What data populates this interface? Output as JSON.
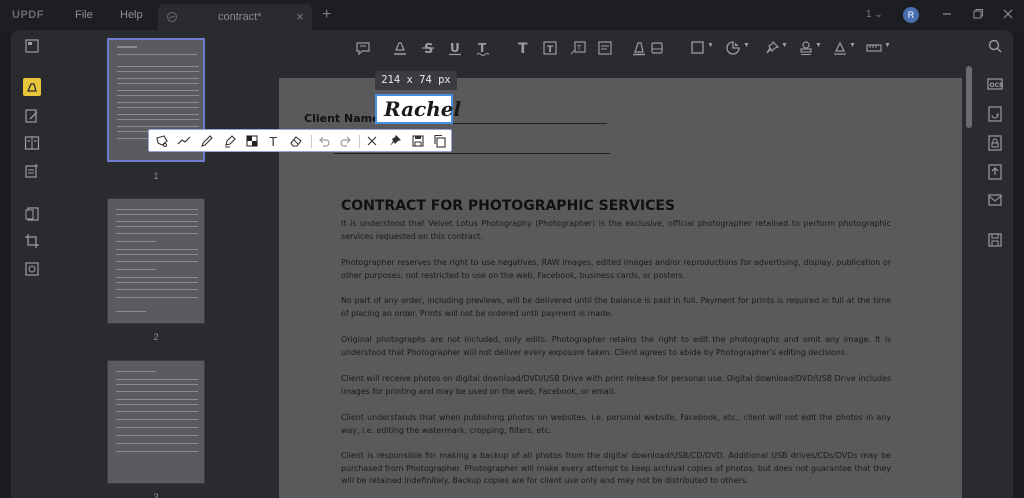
{
  "app": {
    "logo": "UPDF",
    "menu": [
      "File",
      "Help"
    ],
    "tab_title": "contract*",
    "page_indicator": "1",
    "avatar_letter": "R"
  },
  "thumbnails": [
    {
      "page": "1"
    },
    {
      "page": "2"
    },
    {
      "page": "3"
    }
  ],
  "signature": {
    "size_tooltip": "214  x  74  px",
    "text": "Rachel"
  },
  "document": {
    "client_label": "Client Name:",
    "title": "CONTRACT FOR PHOTOGRAPHIC SERVICES",
    "paragraphs": [
      "It is understood that Velvet Lotus Photography (Photographer) is the exclusive, official photographer retained to perform photographic services requested on this contract.",
      "Photographer reserves the right to use negatives, RAW images, edited images and/or reproductions for advertising, display, publication or other purposes, not restricted to use on the web, Facebook, business cards, or posters.",
      "No part of any order, including previews, will be delivered until the balance is paid in full. Payment for prints is required in full at the time of placing an order. Prints will not be ordered until payment is made.",
      "Original photographs are not included, only edits. Photographer retains the right to edit the photographs and omit any image. It is understood that Photographer will not deliver every exposure taken. Client agrees to abide by Photographer's editing decisions.",
      "Client will receive photos on digital download/DVD/USB Drive with print release for personal use. Digital download/DVD/USB Drive includes images for printing and may be used on the web, Facebook, or email.",
      "Client understands that when publishing photos on websites, i.e. personal website, Facebook, etc., client will not edit the photos in any way, i.e. editing the watermark, cropping, filters, etc.",
      "Client is responsible for making a backup of all photos from the digital download/USB/CD/DVD. Additional USB drives/CDs/DVDs may be purchased from Photographer. Photographer will make every attempt to keep archival copies of photos, but does not guarantee that they will be retained indefinitely. Backup copies are for client use only and may not be distributed to others."
    ]
  },
  "colors": {
    "accent": "#6f7bd0",
    "selection": "#4a90e2",
    "highlight": "#e8c53a"
  }
}
